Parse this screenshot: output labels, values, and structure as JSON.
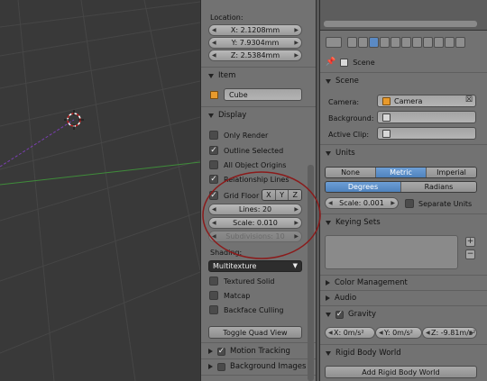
{
  "n_panel": {
    "location": {
      "label": "Location:",
      "x": "X: 2.1208mm",
      "y": "Y: 7.9304mm",
      "z": "Z: 2.5384mm"
    },
    "item": {
      "header": "Item",
      "name": "Cube"
    },
    "display": {
      "header": "Display",
      "only_render": "Only Render",
      "outline_selected": "Outline Selected",
      "all_object_origins": "All Object Origins",
      "relationship_lines": "Relationship Lines",
      "grid_floor": "Grid Floor",
      "axis_x": "X",
      "axis_y": "Y",
      "axis_z": "Z",
      "lines": "Lines: 20",
      "scale": "Scale: 0.010",
      "subdivisions": "Subdivisions: 10",
      "shading_label": "Shading:",
      "shading_value": "Multitexture",
      "textured_solid": "Textured Solid",
      "matcap": "Matcap",
      "backface_culling": "Backface Culling",
      "toggle_quad_view": "Toggle Quad View"
    },
    "motion_tracking": "Motion Tracking",
    "background_images": "Background Images"
  },
  "properties": {
    "breadcrumb": "Scene",
    "scene": {
      "header": "Scene",
      "camera_label": "Camera:",
      "camera_value": "Camera",
      "background_label": "Background:",
      "active_clip_label": "Active Clip:"
    },
    "units": {
      "header": "Units",
      "systems": [
        "None",
        "Metric",
        "Imperial"
      ],
      "active_system": "Metric",
      "rotation": [
        "Degrees",
        "Radians"
      ],
      "active_rotation": "Degrees",
      "scale": "Scale: 0.001",
      "separate_units": "Separate Units"
    },
    "keying_sets": {
      "header": "Keying Sets",
      "add": "+",
      "remove": "−"
    },
    "color_management": "Color Management",
    "audio": "Audio",
    "gravity": {
      "header": "Gravity",
      "x": "X: 0m/s²",
      "y": "Y: 0m/s²",
      "z": "Z: -9.81m/s²"
    },
    "rigid_body_world": {
      "header": "Rigid Body World",
      "add_button": "Add Rigid Body World"
    }
  },
  "colors": {
    "accent_blue": "#5b8ac4",
    "annotation_red": "#8b1a1a",
    "grid_line": "#4a4a4a"
  }
}
